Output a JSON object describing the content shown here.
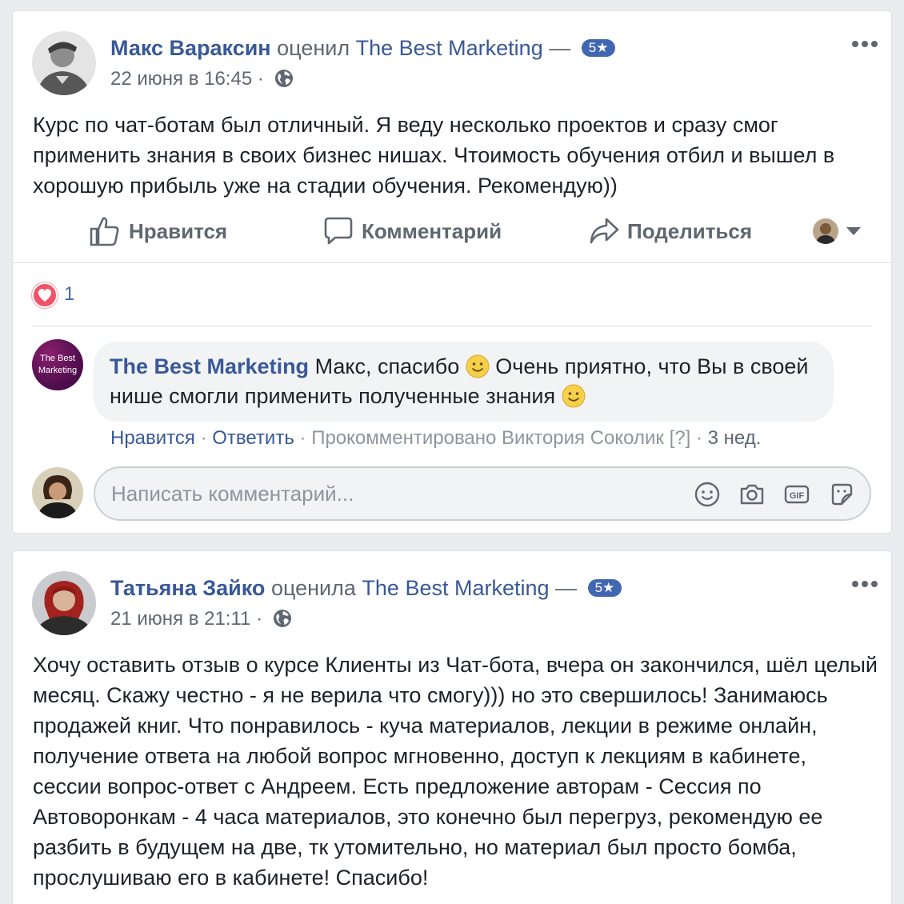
{
  "colors": {
    "link": "#385898",
    "accent": "#4267b2",
    "heart": "#f25268",
    "muted": "#606770"
  },
  "posts": [
    {
      "author": "Макс Вараксин",
      "verb": "оценил",
      "page": "The Best Marketing",
      "dash": "—",
      "rating": "5★",
      "date": "22 июня в 16:45",
      "sep": "·",
      "text": "Курс по чат-ботам был отличный. Я веду несколько проектов и сразу смог применить знания в своих бизнес нишах. Чтоимость обучения отбил и вышел в хорошую прибыль уже на стадии обучения. Рекомендую))"
    },
    {
      "author": "Татьяна Зайко",
      "verb": "оценила",
      "page": "The Best Marketing",
      "dash": "—",
      "rating": "5★",
      "date": "21 июня в 21:11",
      "sep": "·",
      "text": "Хочу оставить отзыв о курсе Клиенты из Чат-бота, вчера он закончился, шёл целый месяц. Скажу честно - я не верила что смогу))) но это свершилось! Занимаюсь продажей книг. Что понравилось - куча материалов, лекции в режиме онлайн, получение ответа на любой вопрос мгновенно, доступ к лекциям в кабинете, сессии вопрос-ответ с Андреем. Есть предложение авторам - Сессия по Автоворонкам - 4 часа материалов, это конечно был перегруз, рекомендую ее разбить в будущем на две, тк утомительно, но материал был просто бомба, прослушиваю его в кабинете! Спасибо!"
    }
  ],
  "actions": {
    "like": "Нравится",
    "comment": "Комментарий",
    "share": "Поделиться"
  },
  "reactions": {
    "count": "1"
  },
  "comment": {
    "author": "The Best Marketing",
    "avatar_text_1": "The Best",
    "avatar_text_2": "Marketing",
    "text_1": "Макс, спасибо",
    "text_2": "Очень приятно, что Вы в своей",
    "text_3": "нише смогли применить полученные знания",
    "like": "Нравится",
    "sep": "·",
    "reply": "Ответить",
    "commented_by": "Прокомментировано Виктория Соколик",
    "help": "[?]",
    "time": "3 нед."
  },
  "composer": {
    "placeholder": "Написать комментарий..."
  },
  "icons": [
    "thumbs-up-icon",
    "comment-icon",
    "share-icon",
    "globe-icon",
    "more-icon",
    "smile-emoji-icon",
    "camera-icon",
    "gif-icon",
    "sticker-icon",
    "heart-icon",
    "caret-down-icon"
  ]
}
